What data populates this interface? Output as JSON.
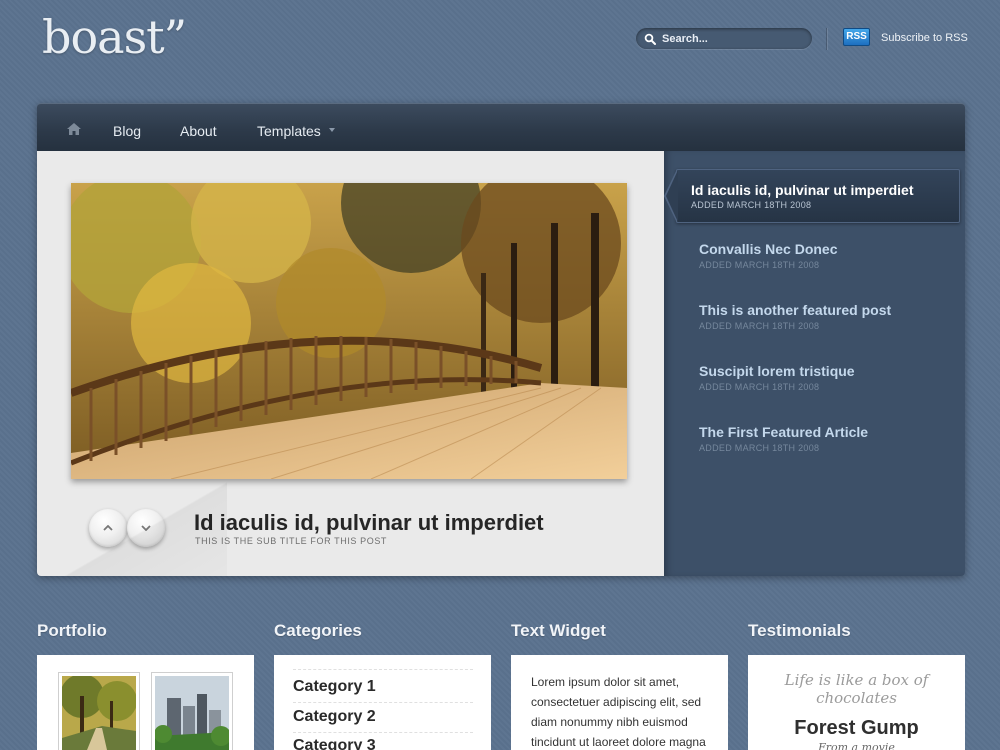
{
  "header": {
    "logo": "boast”",
    "search_placeholder": "Search...",
    "rss_badge": "RSS",
    "subscribe_label": "Subscribe to RSS"
  },
  "nav": {
    "items": [
      {
        "label": "Blog"
      },
      {
        "label": "About"
      },
      {
        "label": "Templates"
      }
    ]
  },
  "featured": {
    "main_title": "Id iaculis id, pulvinar ut imperdiet",
    "main_subtitle": "THIS IS THE SUB TITLE FOR THIS POST",
    "posts": [
      {
        "title": "Id iaculis id, pulvinar ut imperdiet",
        "date": "ADDED MARCH 18TH 2008",
        "active": true
      },
      {
        "title": "Convallis Nec Donec",
        "date": "ADDED MARCH 18TH 2008"
      },
      {
        "title": "This is another featured post",
        "date": "ADDED MARCH 18TH 2008"
      },
      {
        "title": "Suscipit lorem tristique",
        "date": "ADDED MARCH 18TH 2008"
      },
      {
        "title": "The First Featured Article",
        "date": "ADDED MARCH 18TH 2008"
      }
    ]
  },
  "widgets": {
    "portfolio": {
      "title": "Portfolio"
    },
    "categories": {
      "title": "Categories",
      "items": [
        "Category 1",
        "Category 2",
        "Category 3"
      ]
    },
    "text": {
      "title": "Text Widget",
      "body": "Lorem ipsum dolor sit amet, consectetuer adipiscing elit, sed diam nonummy nibh euismod tincidunt ut laoreet dolore magna"
    },
    "testimonials": {
      "title": "Testimonials",
      "quote": "Life is like a box of chocolates",
      "name": "Forest Gump",
      "source": "From a movie"
    }
  },
  "colors": {
    "background": "#5b728f",
    "nav_bar": "#2d3a4a",
    "feature_panel": "#3d5068",
    "feature_link": "#c4d8ec",
    "rss_blue": "#2a86d6"
  }
}
